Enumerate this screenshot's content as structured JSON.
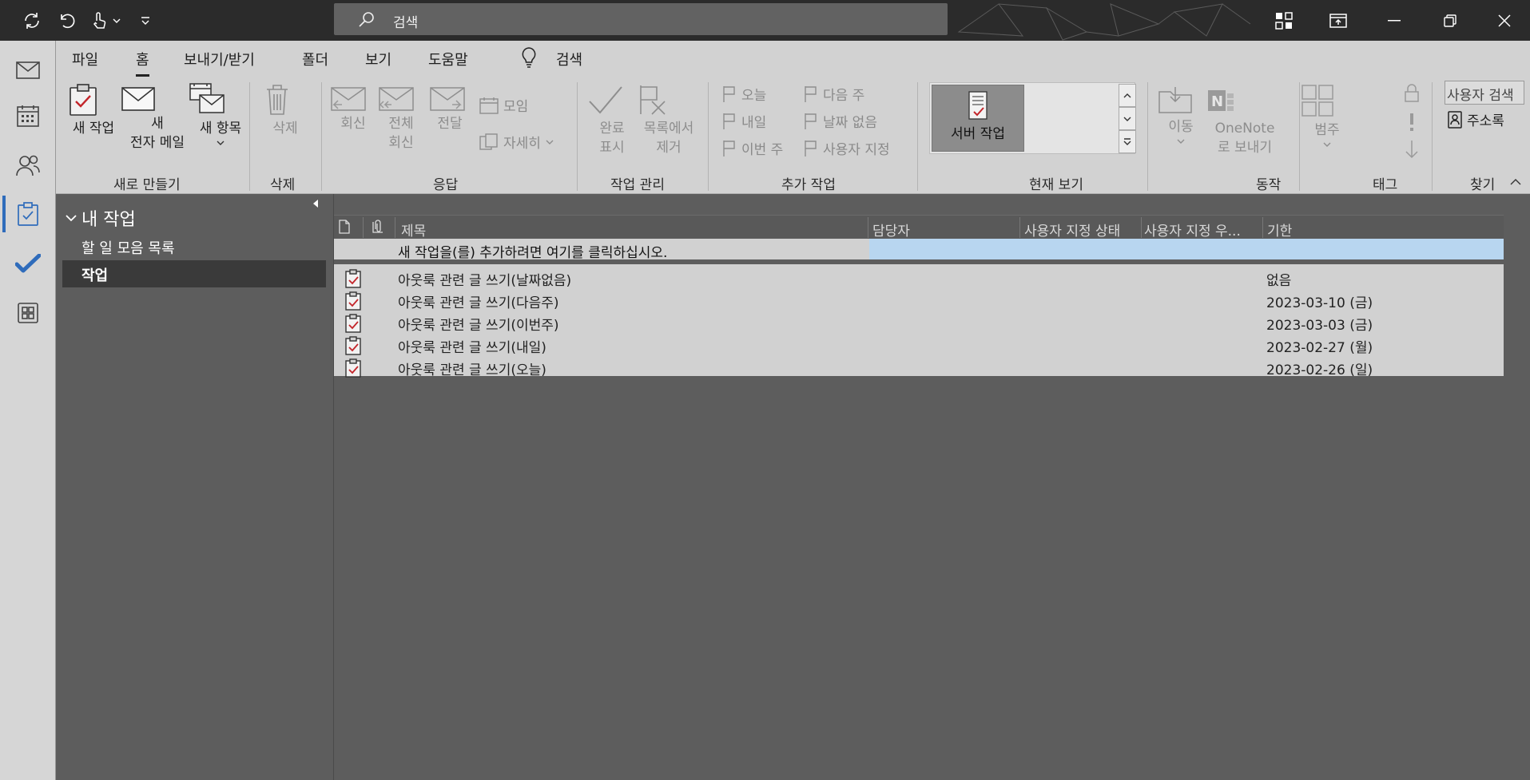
{
  "titlebar": {
    "search_placeholder": "검색"
  },
  "ribbon": {
    "tabs": [
      {
        "label": "파일"
      },
      {
        "label": "홈"
      },
      {
        "label": "보내기/받기"
      },
      {
        "label": "폴더"
      },
      {
        "label": "보기"
      },
      {
        "label": "도움말"
      }
    ],
    "tell_me": "검색",
    "groups": {
      "new": {
        "label": "새로 만들기",
        "new_task": "새 작업",
        "new_email_line1": "새",
        "new_email_line2": "전자 메일",
        "new_items": "새 항목"
      },
      "delete": {
        "label": "삭제",
        "delete": "삭제"
      },
      "respond": {
        "label": "응답",
        "reply": "회신",
        "reply_all_line1": "전체",
        "reply_all_line2": "회신",
        "forward": "전달",
        "meeting": "모임",
        "more": "자세히"
      },
      "manage": {
        "label": "작업 관리",
        "mark_complete_line1": "완료",
        "mark_complete_line2": "표시",
        "remove_line1": "목록에서",
        "remove_line2": "제거"
      },
      "followup": {
        "label": "추가 작업",
        "today": "오늘",
        "tomorrow": "내일",
        "this_week": "이번 주",
        "next_week": "다음 주",
        "no_date": "날짜 없음",
        "custom": "사용자 지정"
      },
      "current_view": {
        "label": "현재 보기",
        "server_tasks": "서버 작업"
      },
      "actions": {
        "label": "동작",
        "move": "이동",
        "onenote_line1": "OneNote",
        "onenote_line2": "로 보내기"
      },
      "tags": {
        "label": "태그",
        "categorize": "범주"
      },
      "find": {
        "label": "찾기",
        "search_people": "사용자 검색",
        "address_book": "주소록"
      }
    }
  },
  "folders": {
    "root": "내 작업",
    "items": [
      {
        "label": "할 일 모음 목록"
      },
      {
        "label": "작업"
      }
    ]
  },
  "list": {
    "columns": {
      "subject": "제목",
      "owner": "담당자",
      "custom_status": "사용자 지정 상태",
      "custom_priority": "사용자 지정 우...",
      "due": "기한"
    },
    "new_task_prompt": "새 작업을(를) 추가하려면 여기를 클릭하십시오.",
    "rows": [
      {
        "subject": "아웃룩 관련 글 쓰기(날짜없음)",
        "due": "없음"
      },
      {
        "subject": "아웃룩 관련 글 쓰기(다음주)",
        "due": "2023-03-10 (금)"
      },
      {
        "subject": "아웃룩 관련 글 쓰기(이번주)",
        "due": "2023-03-03 (금)"
      },
      {
        "subject": "아웃룩 관련 글 쓰기(내일)",
        "due": "2023-02-27 (월)"
      },
      {
        "subject": "아웃룩 관련 글 쓰기(오늘)",
        "due": "2023-02-26 (일)"
      }
    ]
  },
  "colors": {
    "accent": "#2f6cbb",
    "titlebar": "#2b2b2b",
    "ribbon": "#d2d2d2",
    "pane": "#5d5d5d",
    "selection": "#b8d6f0"
  }
}
